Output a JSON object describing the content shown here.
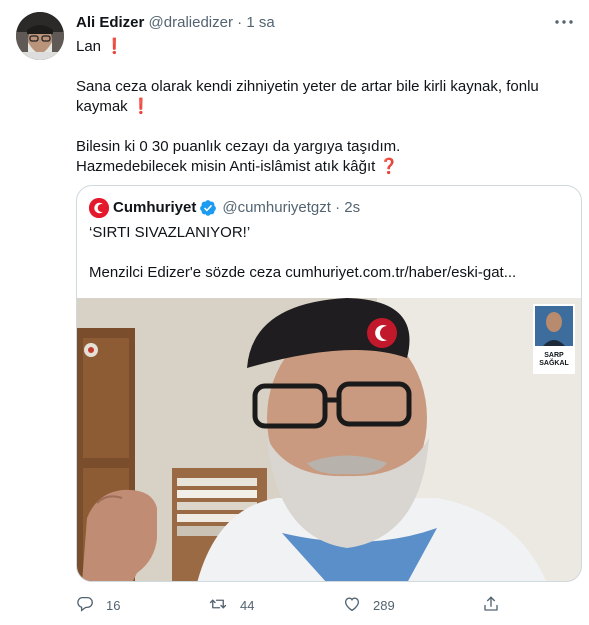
{
  "tweet": {
    "author_name": "Ali Edizer",
    "handle": "@draliedizer",
    "separator": "·",
    "time": "1 sa",
    "lines": [
      "Lan",
      "Sana ceza olarak kendi zihniyetin yeter de artar bile kirli kaynak, fonlu",
      "kaymak",
      "Bilesin ki 0 30 puanlık cezayı da yargıya taşıdım.",
      "Hazmedebilecek misin Anti-islâmist atık kâğıt"
    ],
    "emoji_exclamation": "❗",
    "emoji_question": "❓"
  },
  "quote": {
    "author_name": "Cumhuriyet",
    "handle": "@cumhuriyetgzt",
    "separator": "·",
    "time": "2s",
    "line1": "‘SIRTI SIVAZLANIYOR!’",
    "line2": "Menzilci Edizer'e sözde ceza cumhuriyet.com.tr/haber/eski-gat...",
    "inset_caption_line1": "SARP",
    "inset_caption_line2": "SAĞKAL"
  },
  "actions": {
    "replies": "16",
    "retweets": "44",
    "likes": "289"
  },
  "icons": {
    "more": "more-icon",
    "reply": "reply-icon",
    "retweet": "retweet-icon",
    "like": "heart-icon",
    "share": "share-icon",
    "verified": "verified-badge-icon"
  },
  "colors": {
    "text": "#0f1419",
    "secondary": "#536471",
    "verified": "#1d9bf0",
    "emoji_red": "#e0245e",
    "border": "#cfd9de",
    "brand_red": "#e4192c"
  }
}
